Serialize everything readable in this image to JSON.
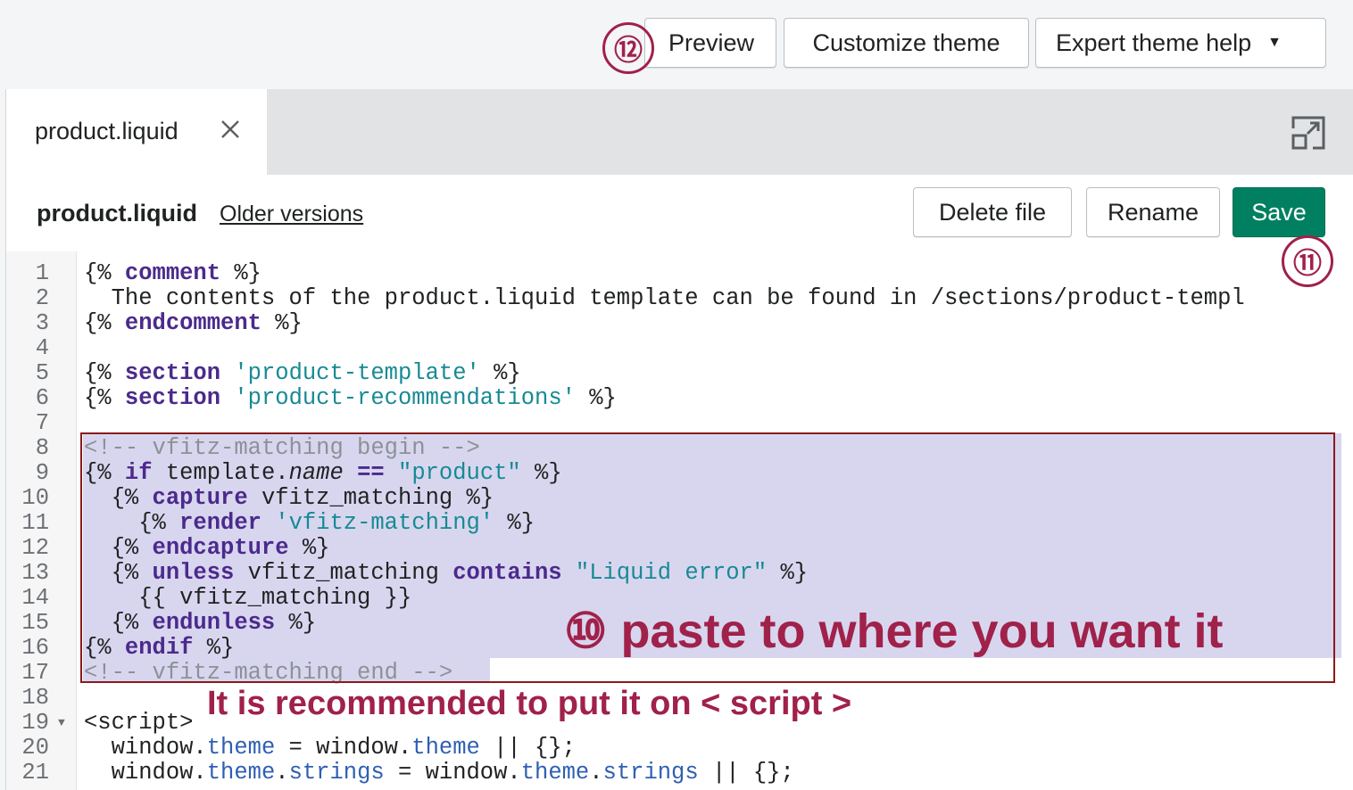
{
  "topbar": {
    "preview_label": "Preview",
    "customize_label": "Customize theme",
    "expert_label": "Expert theme help",
    "expert_caret": "▼"
  },
  "tab": {
    "label": "product.liquid",
    "close_glyph": "✕"
  },
  "filebar": {
    "title": "product.liquid",
    "older_versions": "Older versions",
    "delete_label": "Delete file",
    "rename_label": "Rename",
    "save_label": "Save"
  },
  "code_lines": [
    {
      "n": "1",
      "tokens": [
        [
          "p",
          "{% "
        ],
        [
          "kw",
          "comment"
        ],
        [
          "p",
          " %}"
        ]
      ]
    },
    {
      "n": "2",
      "tokens": [
        [
          "p",
          "  The contents of the product.liquid template can be found in /sections/product-templ"
        ]
      ]
    },
    {
      "n": "3",
      "tokens": [
        [
          "p",
          "{% "
        ],
        [
          "kw",
          "endcomment"
        ],
        [
          "p",
          " %}"
        ]
      ]
    },
    {
      "n": "4",
      "tokens": []
    },
    {
      "n": "5",
      "tokens": [
        [
          "p",
          "{% "
        ],
        [
          "kw",
          "section"
        ],
        [
          "p",
          " "
        ],
        [
          "str",
          "'product-template'"
        ],
        [
          "p",
          " %}"
        ]
      ]
    },
    {
      "n": "6",
      "tokens": [
        [
          "p",
          "{% "
        ],
        [
          "kw",
          "section"
        ],
        [
          "p",
          " "
        ],
        [
          "str",
          "'product-recommendations'"
        ],
        [
          "p",
          " %}"
        ]
      ]
    },
    {
      "n": "7",
      "tokens": []
    },
    {
      "n": "8",
      "tokens": [
        [
          "cm",
          "<!-- vfitz-matching begin -->"
        ]
      ]
    },
    {
      "n": "9",
      "tokens": [
        [
          "p",
          "{% "
        ],
        [
          "kw",
          "if"
        ],
        [
          "p",
          " template."
        ],
        [
          "it",
          "name"
        ],
        [
          "p",
          " "
        ],
        [
          "kw",
          "=="
        ],
        [
          "p",
          " "
        ],
        [
          "str",
          "\"product\""
        ],
        [
          "p",
          " %}"
        ]
      ]
    },
    {
      "n": "10",
      "tokens": [
        [
          "p",
          "  {% "
        ],
        [
          "kw",
          "capture"
        ],
        [
          "p",
          " vfitz_matching %}"
        ]
      ]
    },
    {
      "n": "11",
      "tokens": [
        [
          "p",
          "    {% "
        ],
        [
          "kw",
          "render"
        ],
        [
          "p",
          " "
        ],
        [
          "str",
          "'vfitz-matching'"
        ],
        [
          "p",
          " %}"
        ]
      ]
    },
    {
      "n": "12",
      "tokens": [
        [
          "p",
          "  {% "
        ],
        [
          "kw",
          "endcapture"
        ],
        [
          "p",
          " %}"
        ]
      ]
    },
    {
      "n": "13",
      "tokens": [
        [
          "p",
          "  {% "
        ],
        [
          "kw",
          "unless"
        ],
        [
          "p",
          " vfitz_matching "
        ],
        [
          "kw",
          "contains"
        ],
        [
          "p",
          " "
        ],
        [
          "str",
          "\"Liquid error\""
        ],
        [
          "p",
          " %}"
        ]
      ]
    },
    {
      "n": "14",
      "tokens": [
        [
          "p",
          "    {{ vfitz_matching }}"
        ]
      ]
    },
    {
      "n": "15",
      "tokens": [
        [
          "p",
          "  {% "
        ],
        [
          "kw",
          "endunless"
        ],
        [
          "p",
          " %}"
        ]
      ]
    },
    {
      "n": "16",
      "tokens": [
        [
          "p",
          "{% "
        ],
        [
          "kw",
          "endif"
        ],
        [
          "p",
          " %}"
        ]
      ]
    },
    {
      "n": "17",
      "tokens": [
        [
          "cm",
          "<!-- vfitz-matching end -->"
        ]
      ]
    },
    {
      "n": "18",
      "tokens": []
    },
    {
      "n": "19",
      "fold": "▼",
      "tokens": [
        [
          "p",
          "<script>"
        ]
      ]
    },
    {
      "n": "20",
      "tokens": [
        [
          "p",
          "  window."
        ],
        [
          "prop",
          "theme"
        ],
        [
          "p",
          " = window."
        ],
        [
          "prop",
          "theme"
        ],
        [
          "p",
          " || {};"
        ]
      ]
    },
    {
      "n": "21",
      "tokens": [
        [
          "p",
          "  window."
        ],
        [
          "prop",
          "theme"
        ],
        [
          "p",
          "."
        ],
        [
          "prop",
          "strings"
        ],
        [
          "p",
          " = window."
        ],
        [
          "prop",
          "theme"
        ],
        [
          "p",
          "."
        ],
        [
          "prop",
          "strings"
        ],
        [
          "p",
          " || {};"
        ]
      ]
    }
  ],
  "annotations": {
    "step10_num": "⑩",
    "step10_text": "paste to where you want it",
    "step11_num": "⑪",
    "step12_num": "⑫",
    "recommend_text": "It is recommended to put it on < script >"
  },
  "colors": {
    "save_green": "#008060",
    "annotation": "#a0214a",
    "selection": "#d8d6ef",
    "keyword": "#4b2a8c",
    "string": "#178a94"
  },
  "icons": [
    "close-icon",
    "expand-icon",
    "caret-down-icon",
    "fold-arrow-icon"
  ]
}
